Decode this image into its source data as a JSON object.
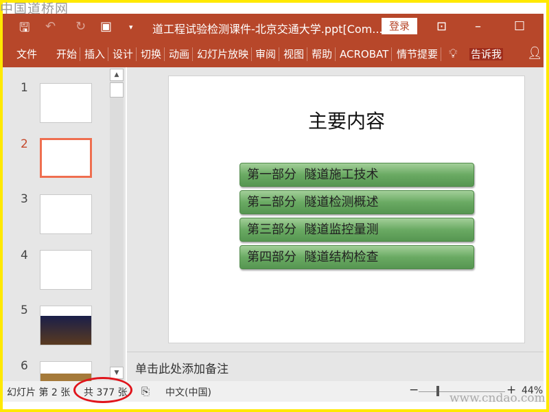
{
  "watermark_top": "中国道桥网",
  "watermark_bottom": "www.cndao.com",
  "titlebar": {
    "title": "道工程试验检测课件-北京交通大学.ppt[Com...",
    "login": "登录"
  },
  "ribbon": {
    "tabs": [
      "文件",
      "开始",
      "插入",
      "设计",
      "切换",
      "动画",
      "幻灯片放映",
      "审阅",
      "视图",
      "帮助",
      "ACROBAT",
      "情节提要"
    ],
    "tell_me": "告诉我"
  },
  "thumbnails": [
    {
      "num": "1"
    },
    {
      "num": "2"
    },
    {
      "num": "3"
    },
    {
      "num": "4"
    },
    {
      "num": "5"
    },
    {
      "num": "6"
    }
  ],
  "slide": {
    "title": "主要内容",
    "items": [
      "第一部分  隧道施工技术",
      "第二部分  隧道检测概述",
      "第三部分  隧道监控量测",
      "第四部分  隧道结构检查"
    ]
  },
  "notes_placeholder": "单击此处添加备注",
  "status": {
    "slide": "幻灯片 第 2 张",
    "total": "共 377 张",
    "language": "中文(中国)",
    "zoom": "44%",
    "zoom_minus": "−",
    "zoom_plus": "+"
  },
  "colors": {
    "accent": "#b7472a",
    "selection": "#ef6e4f"
  }
}
